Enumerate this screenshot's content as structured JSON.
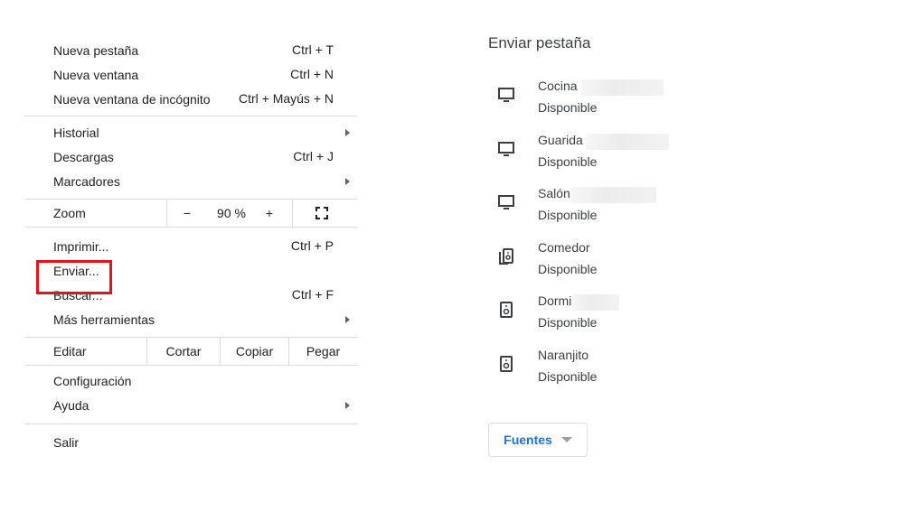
{
  "menu": {
    "new_tab": {
      "label": "Nueva pestaña",
      "shortcut": "Ctrl + T"
    },
    "new_window": {
      "label": "Nueva ventana",
      "shortcut": "Ctrl + N"
    },
    "incognito": {
      "label": "Nueva ventana de incógnito",
      "shortcut": "Ctrl + Mayús + N"
    },
    "history": {
      "label": "Historial"
    },
    "downloads": {
      "label": "Descargas",
      "shortcut": "Ctrl + J"
    },
    "bookmarks": {
      "label": "Marcadores"
    },
    "zoom": {
      "label": "Zoom",
      "minus": "−",
      "value": "90 %",
      "plus": "+"
    },
    "print": {
      "label": "Imprimir...",
      "shortcut": "Ctrl + P"
    },
    "cast": {
      "label": "Enviar..."
    },
    "find": {
      "label": "Buscar...",
      "shortcut": "Ctrl + F"
    },
    "more_tools": {
      "label": "Más herramientas"
    },
    "edit": {
      "label": "Editar",
      "cut": "Cortar",
      "copy": "Copiar",
      "paste": "Pegar"
    },
    "settings": {
      "label": "Configuración"
    },
    "help": {
      "label": "Ayuda"
    },
    "exit": {
      "label": "Salir"
    }
  },
  "cast_panel": {
    "title": "Enviar pestaña",
    "devices": [
      {
        "name": "Cocina",
        "status": "Disponible",
        "icon": "monitor-icon"
      },
      {
        "name": "Guarida",
        "status": "Disponible",
        "icon": "monitor-icon"
      },
      {
        "name": "Salón",
        "status": "Disponible",
        "icon": "monitor-icon"
      },
      {
        "name": "Comedor",
        "status": "Disponible",
        "icon": "speaker-group-icon"
      },
      {
        "name": "Dormi",
        "status": "Disponible",
        "icon": "speaker-icon"
      },
      {
        "name": "Naranjito",
        "status": "Disponible",
        "icon": "speaker-icon"
      }
    ],
    "sources_button": "Fuentes"
  },
  "colors": {
    "highlight": "#e8101a",
    "accent": "#1a73e8",
    "separator": "#dadce0"
  }
}
